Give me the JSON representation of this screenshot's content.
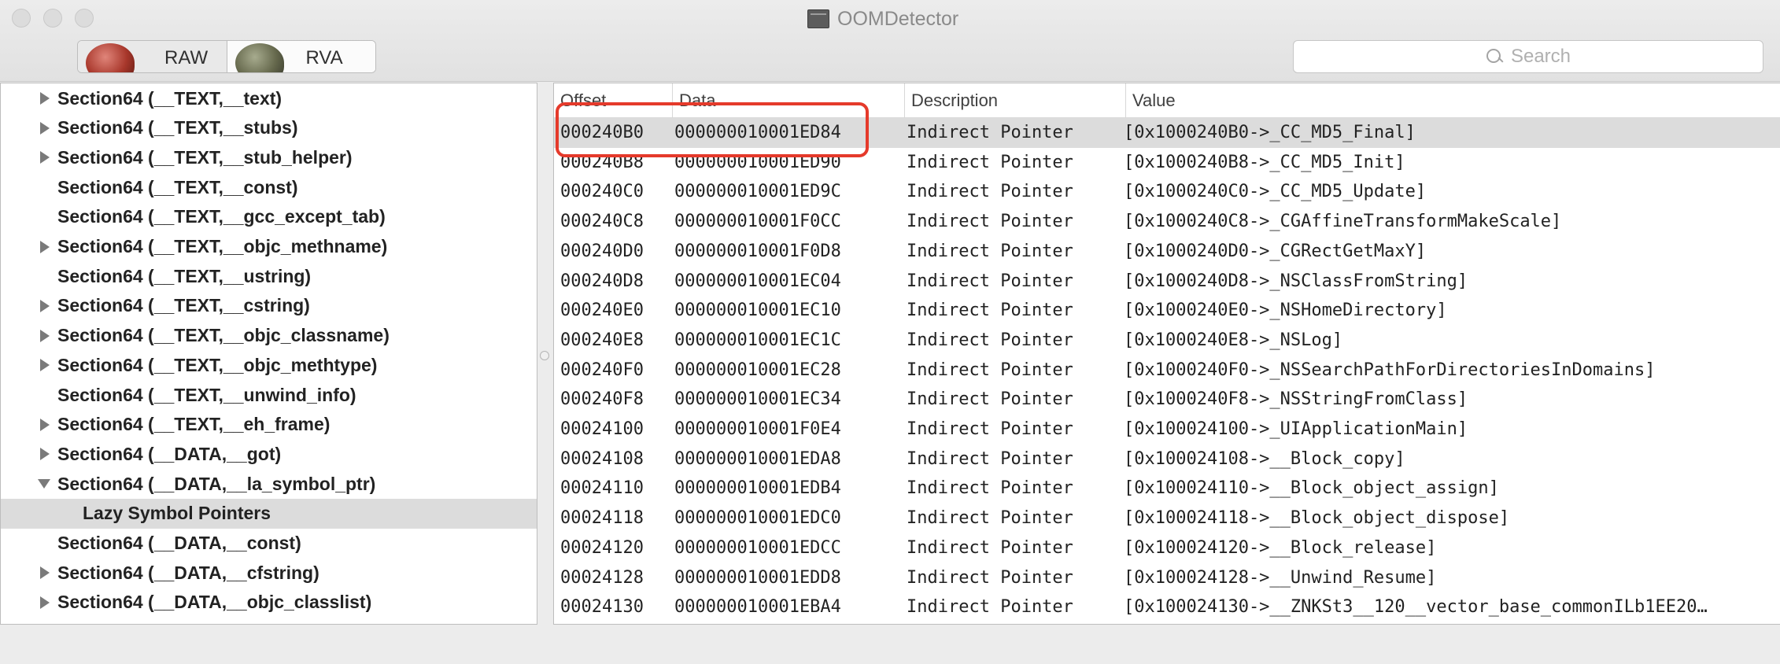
{
  "window": {
    "title": "OOMDetector"
  },
  "toolbar": {
    "segments": [
      {
        "label": "RAW",
        "selected": false
      },
      {
        "label": "RVA",
        "selected": true
      }
    ],
    "search": {
      "placeholder": "Search",
      "value": ""
    }
  },
  "sidebar": {
    "items": [
      {
        "label": "Section64 (__TEXT,__text)",
        "disclosure": "closed"
      },
      {
        "label": "Section64 (__TEXT,__stubs)",
        "disclosure": "closed"
      },
      {
        "label": "Section64 (__TEXT,__stub_helper)",
        "disclosure": "closed"
      },
      {
        "label": "Section64 (__TEXT,__const)",
        "disclosure": "none"
      },
      {
        "label": "Section64 (__TEXT,__gcc_except_tab)",
        "disclosure": "none"
      },
      {
        "label": "Section64 (__TEXT,__objc_methname)",
        "disclosure": "closed"
      },
      {
        "label": "Section64 (__TEXT,__ustring)",
        "disclosure": "none"
      },
      {
        "label": "Section64 (__TEXT,__cstring)",
        "disclosure": "closed"
      },
      {
        "label": "Section64 (__TEXT,__objc_classname)",
        "disclosure": "closed"
      },
      {
        "label": "Section64 (__TEXT,__objc_methtype)",
        "disclosure": "closed"
      },
      {
        "label": "Section64 (__TEXT,__unwind_info)",
        "disclosure": "none"
      },
      {
        "label": "Section64 (__TEXT,__eh_frame)",
        "disclosure": "closed"
      },
      {
        "label": "Section64 (__DATA,__got)",
        "disclosure": "closed"
      },
      {
        "label": "Section64 (__DATA,__la_symbol_ptr)",
        "disclosure": "open"
      },
      {
        "label": "Lazy Symbol Pointers",
        "disclosure": "none",
        "child": true,
        "selected": true
      },
      {
        "label": "Section64 (__DATA,__const)",
        "disclosure": "none"
      },
      {
        "label": "Section64 (__DATA,__cfstring)",
        "disclosure": "closed"
      },
      {
        "label": "Section64 (__DATA,__objc_classlist)",
        "disclosure": "closed"
      }
    ]
  },
  "table": {
    "columns": [
      "Offset",
      "Data",
      "Description",
      "Value"
    ],
    "rows": [
      {
        "offset": "000240B0",
        "data": "000000010001ED84",
        "description": "Indirect Pointer",
        "value": "[0x1000240B0->_CC_MD5_Final]",
        "selected": true
      },
      {
        "offset": "000240B8",
        "data": "000000010001ED90",
        "description": "Indirect Pointer",
        "value": "[0x1000240B8->_CC_MD5_Init]"
      },
      {
        "offset": "000240C0",
        "data": "000000010001ED9C",
        "description": "Indirect Pointer",
        "value": "[0x1000240C0->_CC_MD5_Update]"
      },
      {
        "offset": "000240C8",
        "data": "000000010001F0CC",
        "description": "Indirect Pointer",
        "value": "[0x1000240C8->_CGAffineTransformMakeScale]"
      },
      {
        "offset": "000240D0",
        "data": "000000010001F0D8",
        "description": "Indirect Pointer",
        "value": "[0x1000240D0->_CGRectGetMaxY]"
      },
      {
        "offset": "000240D8",
        "data": "000000010001EC04",
        "description": "Indirect Pointer",
        "value": "[0x1000240D8->_NSClassFromString]"
      },
      {
        "offset": "000240E0",
        "data": "000000010001EC10",
        "description": "Indirect Pointer",
        "value": "[0x1000240E0->_NSHomeDirectory]"
      },
      {
        "offset": "000240E8",
        "data": "000000010001EC1C",
        "description": "Indirect Pointer",
        "value": "[0x1000240E8->_NSLog]"
      },
      {
        "offset": "000240F0",
        "data": "000000010001EC28",
        "description": "Indirect Pointer",
        "value": "[0x1000240F0->_NSSearchPathForDirectoriesInDomains]"
      },
      {
        "offset": "000240F8",
        "data": "000000010001EC34",
        "description": "Indirect Pointer",
        "value": "[0x1000240F8->_NSStringFromClass]"
      },
      {
        "offset": "00024100",
        "data": "000000010001F0E4",
        "description": "Indirect Pointer",
        "value": "[0x100024100->_UIApplicationMain]"
      },
      {
        "offset": "00024108",
        "data": "000000010001EDA8",
        "description": "Indirect Pointer",
        "value": "[0x100024108->__Block_copy]"
      },
      {
        "offset": "00024110",
        "data": "000000010001EDB4",
        "description": "Indirect Pointer",
        "value": "[0x100024110->__Block_object_assign]"
      },
      {
        "offset": "00024118",
        "data": "000000010001EDC0",
        "description": "Indirect Pointer",
        "value": "[0x100024118->__Block_object_dispose]"
      },
      {
        "offset": "00024120",
        "data": "000000010001EDCC",
        "description": "Indirect Pointer",
        "value": "[0x100024120->__Block_release]"
      },
      {
        "offset": "00024128",
        "data": "000000010001EDD8",
        "description": "Indirect Pointer",
        "value": "[0x100024128->__Unwind_Resume]"
      },
      {
        "offset": "00024130",
        "data": "000000010001EBA4",
        "description": "Indirect Pointer",
        "value": "[0x100024130->__ZNKSt3__120__vector_base_commonILb1EE20…"
      }
    ]
  },
  "colors": {
    "annotation": "#e53a2b",
    "selection": "#dcdcdc"
  }
}
